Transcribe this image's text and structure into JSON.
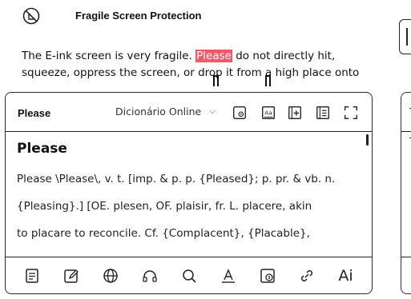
{
  "header": {
    "title": "Fragile Screen Protection",
    "icon": "no-touch-icon"
  },
  "body": {
    "line1_before": "The E-ink screen is very fragile. ",
    "line1_highlight": "Please",
    "line1_after": " do not directly hit,",
    "line2": "squeeze, oppress the screen, or drop it from a high place onto"
  },
  "popup": {
    "word": "Please",
    "dictionary": "Dicionário Online",
    "headword": "Please",
    "definition_lines": [
      "Please \\Please\\, v. t. [imp. & p. p. {Pleased}; p. pr. & vb. n.",
      "{Pleasing}.] [OE. plesen, OF. plaisir, fr. L. placere, akin",
      "to placare to reconcile. Cf. {Complacent}, {Placable},"
    ],
    "top_icons": [
      "screenshot-icon",
      "text-size-icon",
      "add-word-icon",
      "list-icon",
      "fullscreen-icon"
    ],
    "toolbar": [
      "notes-icon",
      "edit-icon",
      "globe-icon",
      "headphones-icon",
      "search-icon",
      "underline-icon",
      "translate-icon",
      "link-icon",
      "ai-icon"
    ],
    "ai_label": "Ai"
  },
  "right_panel": {
    "t1": "T",
    "t2": "T"
  },
  "colors": {
    "highlight": "#ef5a64",
    "border": "#2a2a2a"
  }
}
